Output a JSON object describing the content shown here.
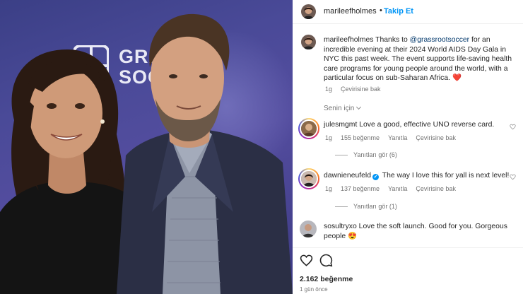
{
  "post": {
    "username": "marileefholmes",
    "dot": "•",
    "follow_label": "Takip Et",
    "caption": {
      "username": "marileefholmes",
      "text_before": "Thanks to ",
      "mention": "@grassrootsoccer",
      "text_after": " for an incredible evening at their 2024 World AIDS Day Gala in NYC this past week. The event supports life-saving health care programs for young people around the world, with a particular focus on sub-Saharan Africa.",
      "emoji": "❤️",
      "age": "1g",
      "translate": "Çevirisine bak"
    },
    "for_you_label": "Senin için",
    "image_logo_text": [
      "GRA",
      "SOC"
    ]
  },
  "comments": [
    {
      "username": "julesmgmt",
      "verified": false,
      "text": "Love a good, effective UNO reverse card.",
      "age": "1g",
      "likes": "155 beğenme",
      "reply": "Yanıtla",
      "translate": "Çevirisine bak",
      "view_replies": "Yanıtları gör (6)"
    },
    {
      "username": "dawnieneufeld",
      "verified": true,
      "text": "The way I love this for yall is next level!",
      "age": "1g",
      "likes": "137 beğenme",
      "reply": "Yanıtla",
      "translate": "Çevirisine bak",
      "view_replies": "Yanıtları gör (1)"
    },
    {
      "username": "sosultryxo",
      "verified": false,
      "text": "Love the soft launch. Good for you. Gorgeous people",
      "emoji": "😍"
    }
  ],
  "footer": {
    "likes": "2.162 beğenme",
    "time": "1 gün önce"
  },
  "icons": {
    "like": "heart-outline-icon",
    "comment": "comment-bubble-icon",
    "comment_like": "small-heart-icon"
  },
  "colors": {
    "accent": "#0095f6",
    "mention": "#00376b",
    "muted": "#737373"
  }
}
